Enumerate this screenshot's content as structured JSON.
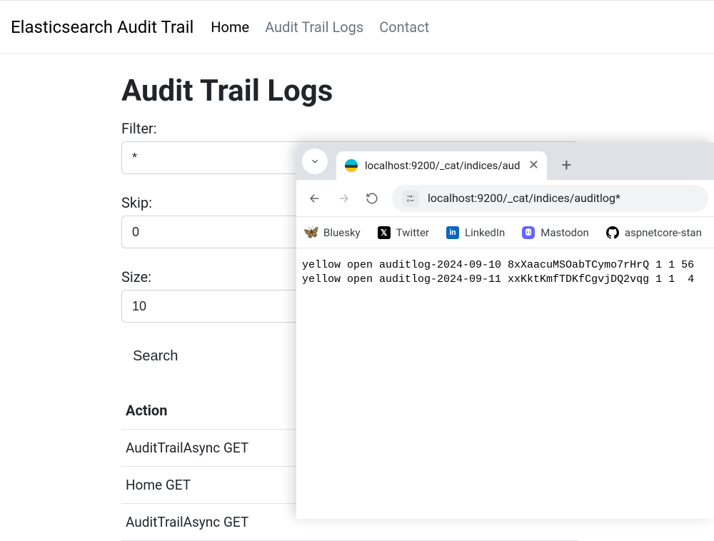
{
  "nav": {
    "brand": "Elasticsearch Audit Trail",
    "links": [
      {
        "label": "Home",
        "active": true
      },
      {
        "label": "Audit Trail Logs",
        "active": false
      },
      {
        "label": "Contact",
        "active": false
      }
    ]
  },
  "page": {
    "title": "Audit Trail Logs",
    "filter_label": "Filter:",
    "filter_value": "*",
    "skip_label": "Skip:",
    "skip_value": "0",
    "size_label": "Size:",
    "size_value": "10",
    "search_button": "Search"
  },
  "table": {
    "header_action": "Action",
    "rows": [
      "AuditTrailAsync GET",
      "Home GET",
      "AuditTrailAsync GET"
    ]
  },
  "browser": {
    "tab_title": "localhost:9200/_cat/indices/aud",
    "url": "localhost:9200/_cat/indices/auditlog*",
    "bookmarks": {
      "bluesky": "Bluesky",
      "twitter": "Twitter",
      "linkedin": "LinkedIn",
      "mastodon": "Mastodon",
      "github": "aspnetcore-stan"
    },
    "body_lines": [
      "yellow open auditlog-2024-09-10 8xXaacuMSOabTCymo7rHrQ 1 1 56",
      "yellow open auditlog-2024-09-11 xxKktKmfTDKfCgvjDQ2vqg 1 1  4"
    ]
  }
}
